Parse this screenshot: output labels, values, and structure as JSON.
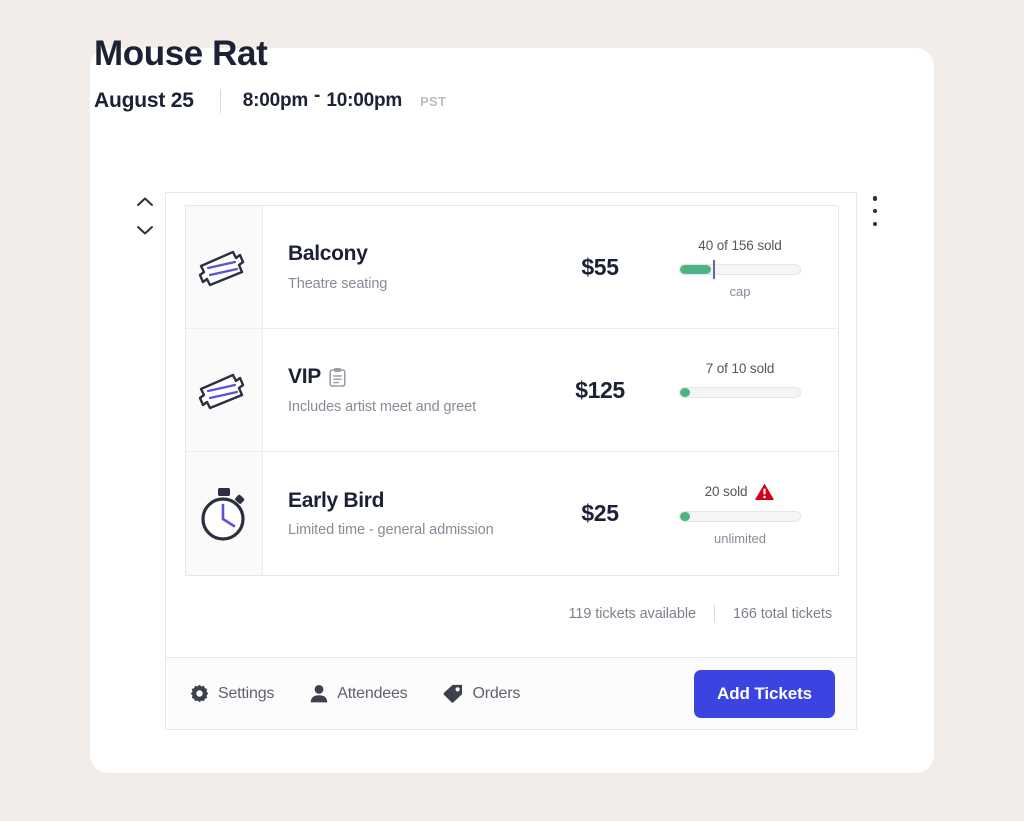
{
  "event": {
    "title": "Mouse Rat",
    "date": "August 25",
    "start_time": "8:00pm",
    "dash": "-",
    "end_time": "10:00pm",
    "timezone": "PST"
  },
  "controls": {
    "sort_icon": "sort-chevrons-icon",
    "menu_icon": "kebab-menu-icon"
  },
  "tickets": [
    {
      "icon": "ticket-icon",
      "name": "Balcony",
      "description": "Theatre seating",
      "price": "$55",
      "sold_text": "40 of 156 sold",
      "bar_caption": "cap",
      "fill_percent": 26,
      "cap_percent": 28,
      "has_cap_marker": true,
      "has_warning": false,
      "badge_icon": ""
    },
    {
      "icon": "ticket-icon",
      "name": "VIP",
      "description": "Includes artist meet and greet",
      "price": "$125",
      "sold_text": "7 of 10 sold",
      "bar_caption": "",
      "fill_percent": 8,
      "cap_percent": 0,
      "has_cap_marker": false,
      "has_warning": false,
      "badge_icon": "clipboard-icon"
    },
    {
      "icon": "stopwatch-icon",
      "name": "Early Bird",
      "description": "Limited time - general admission",
      "price": "$25",
      "sold_text": "20 sold",
      "bar_caption": "unlimited",
      "fill_percent": 8,
      "cap_percent": 0,
      "has_cap_marker": false,
      "has_warning": true,
      "badge_icon": ""
    }
  ],
  "totals": {
    "available": "119 tickets available",
    "total": "166 total tickets"
  },
  "actions": {
    "settings": "Settings",
    "attendees": "Attendees",
    "orders": "Orders",
    "add_tickets": "Add Tickets"
  },
  "colors": {
    "accent_blue": "#3b44e0",
    "progress_green": "#4cb583",
    "warning_red": "#d0021b",
    "title_navy": "#1c2135",
    "page_background": "#f2ede8"
  }
}
